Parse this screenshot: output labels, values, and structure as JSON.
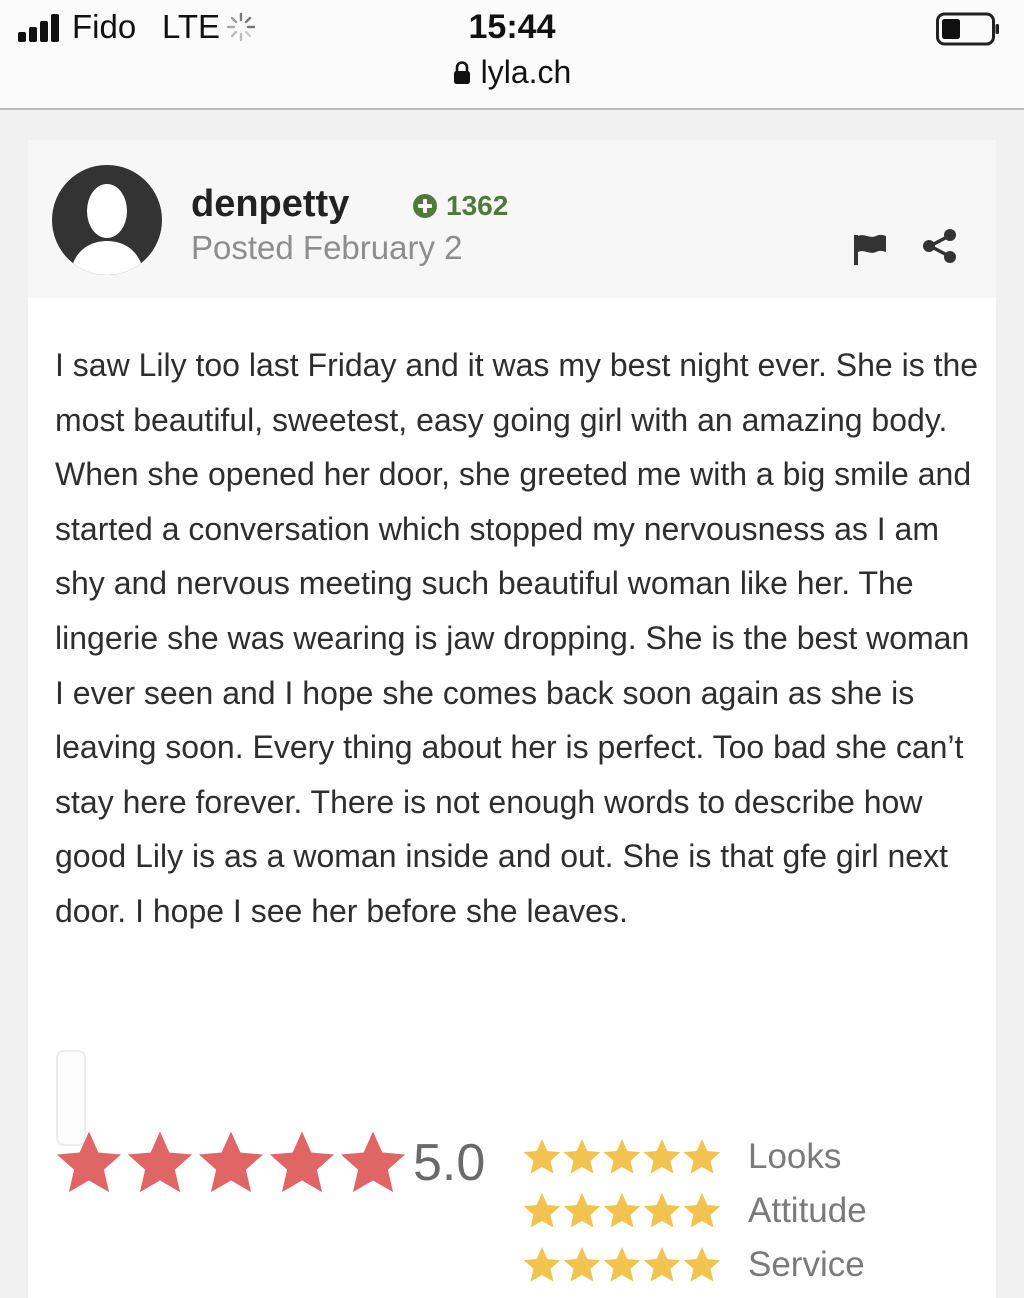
{
  "status_bar": {
    "carrier": "Fido",
    "network": "LTE",
    "time": "15:44",
    "url": "lyla.ch",
    "signal_bars": 4,
    "battery_level": 0.4
  },
  "post": {
    "username": "denpetty",
    "points": "1362",
    "posted": "Posted February 2",
    "body": "I saw Lily too last Friday and it was my best night ever. She is the most beautiful, sweetest, easy going girl with an amazing body. When she opened her door, she greeted me with a big smile and started a conversation which stopped my nervousness as I am shy and nervous meeting such beautiful woman like her. The lingerie she was wearing is jaw dropping. She is the best woman I ever seen and I hope she comes back soon again as she is leaving soon. Every thing about her is perfect. Too bad she can’t stay here forever. There is not enough words to describe how good Lily is as a woman inside and out. She is that gfe girl next door. I hope I see her before she leaves.",
    "rating": {
      "overall_value": "5.0",
      "overall_stars": 5,
      "max_stars": 5,
      "categories": [
        {
          "label": "Looks",
          "stars": 5
        },
        {
          "label": "Attitude",
          "stars": 5
        },
        {
          "label": "Service",
          "stars": 5
        }
      ]
    }
  },
  "icons": {
    "avatar": "default-user-avatar",
    "points": "plus-circle-icon",
    "flag": "flag-icon",
    "share": "share-icon",
    "lock": "lock-icon"
  },
  "colors": {
    "overall_star": "#e06666",
    "category_star": "#f2c44f",
    "points": "#4f7a3a",
    "avatar": "#333333"
  }
}
